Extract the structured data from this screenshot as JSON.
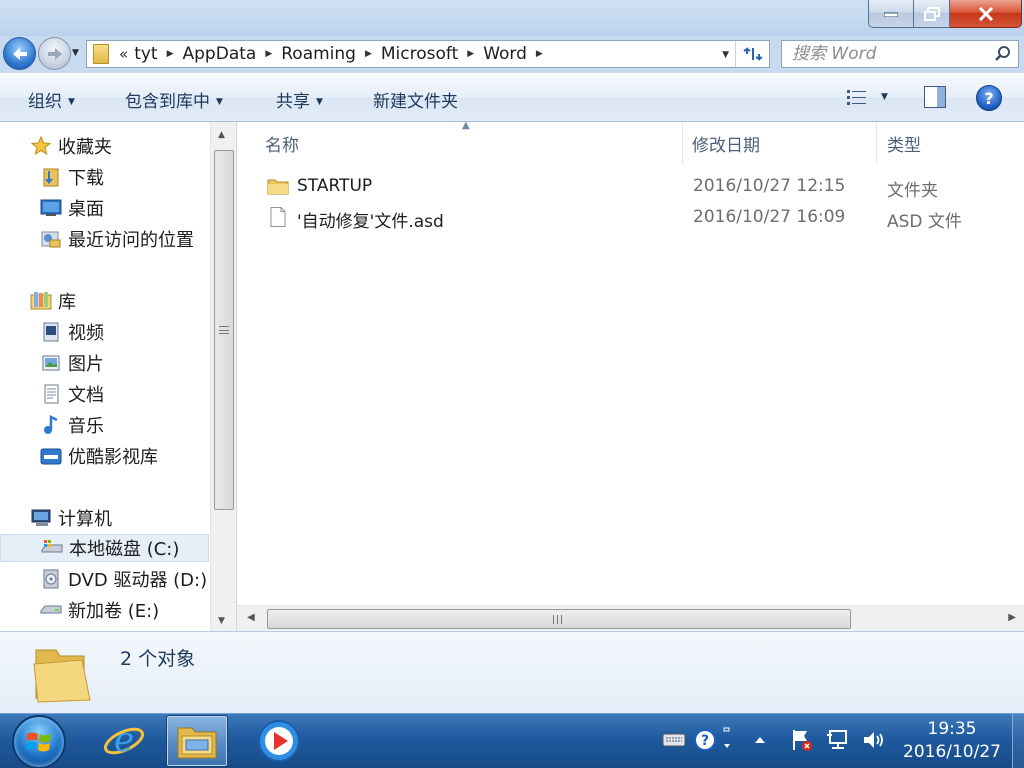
{
  "window": {
    "minimize_label": "",
    "maximize_label": "",
    "close_label": ""
  },
  "address": {
    "overflow": "«",
    "crumbs": [
      "tyt",
      "AppData",
      "Roaming",
      "Microsoft",
      "Word"
    ]
  },
  "search": {
    "placeholder": "搜索 Word"
  },
  "toolbar": {
    "organize": "组织",
    "include_library": "包含到库中",
    "share": "共享",
    "new_folder": "新建文件夹"
  },
  "nav": {
    "favorites": {
      "label": "收藏夹",
      "items": [
        "下载",
        "桌面",
        "最近访问的位置"
      ]
    },
    "libraries": {
      "label": "库",
      "items": [
        "视频",
        "图片",
        "文档",
        "音乐",
        "优酷影视库"
      ]
    },
    "computer": {
      "label": "计算机",
      "items": [
        "本地磁盘 (C:)",
        "DVD 驱动器 (D:) '",
        "新加卷 (E:)"
      ]
    },
    "selected": "本地磁盘 (C:)"
  },
  "columns": {
    "name": "名称",
    "date": "修改日期",
    "type": "类型"
  },
  "files": [
    {
      "name": "STARTUP",
      "date": "2016/10/27 12:15",
      "type": "文件夹",
      "icon": "folder-icon"
    },
    {
      "name": "'自动修复'文件.asd",
      "date": "2016/10/27 16:09",
      "type": "ASD 文件",
      "icon": "document-icon"
    }
  ],
  "details": {
    "count": "2 个对象"
  },
  "taskbar": {
    "time": "19:35",
    "date": "2016/10/27",
    "apps": [
      "internet-explorer-icon",
      "windows-explorer-icon",
      "media-player-icon"
    ]
  },
  "colors": {
    "accent": "#1e395b",
    "selection": "#e6eef8",
    "taskbar": "#1f5a9e"
  }
}
